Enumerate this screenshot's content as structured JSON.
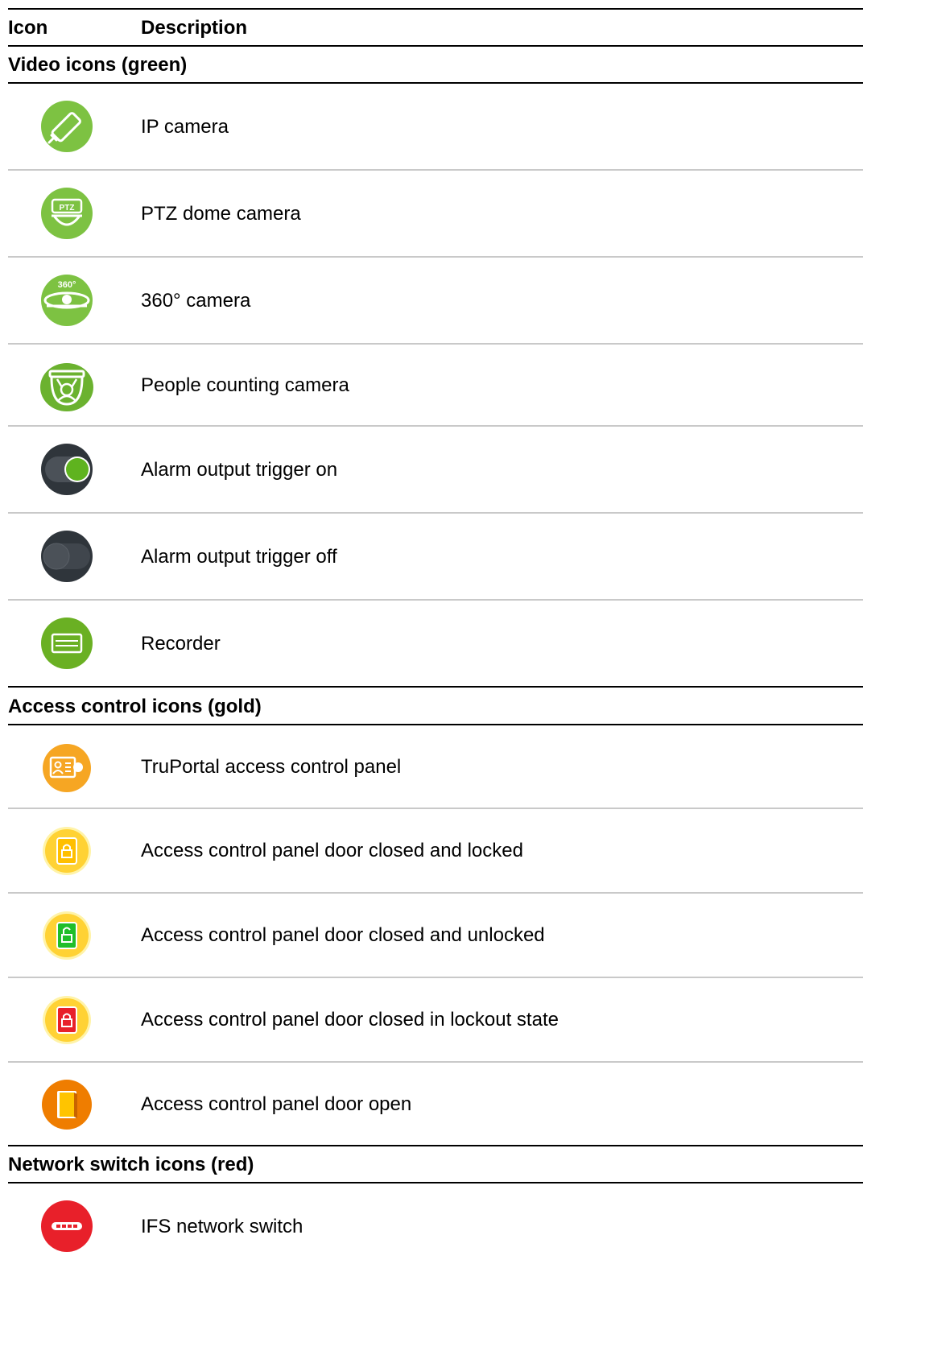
{
  "header": {
    "icon_col": "Icon",
    "desc_col": "Description"
  },
  "sections": {
    "video": {
      "title": "Video icons (green)",
      "rows": [
        {
          "icon": "ip-camera-icon",
          "desc": "IP camera"
        },
        {
          "icon": "ptz-dome-camera-icon",
          "desc": "PTZ dome camera"
        },
        {
          "icon": "360-camera-icon",
          "desc": "360° camera"
        },
        {
          "icon": "people-counting-camera-icon",
          "desc": "People counting camera"
        },
        {
          "icon": "alarm-output-on-icon",
          "desc": "Alarm output trigger on"
        },
        {
          "icon": "alarm-output-off-icon",
          "desc": "Alarm output trigger off"
        },
        {
          "icon": "recorder-icon",
          "desc": "Recorder"
        }
      ]
    },
    "access": {
      "title": "Access control icons (gold)",
      "rows": [
        {
          "icon": "truportal-panel-icon",
          "desc": "TruPortal access control panel"
        },
        {
          "icon": "door-closed-locked-icon",
          "desc": "Access control panel door closed and locked"
        },
        {
          "icon": "door-closed-unlocked-icon",
          "desc": "Access control panel door closed and unlocked"
        },
        {
          "icon": "door-lockout-icon",
          "desc": "Access control panel door closed in lockout state"
        },
        {
          "icon": "door-open-icon",
          "desc": "Access control panel door open"
        }
      ]
    },
    "network": {
      "title": "Network switch icons (red)",
      "rows": [
        {
          "icon": "network-switch-icon",
          "desc": "IFS network switch"
        }
      ]
    }
  },
  "icon_labels": {
    "ptz": "PTZ",
    "360": "360°"
  },
  "colors": {
    "green": "#7dc242",
    "dark": "#2f353b",
    "gold": "#f6a623",
    "yellow": "#ffd234",
    "red": "#e8202a",
    "orange": "#ef7d00"
  }
}
